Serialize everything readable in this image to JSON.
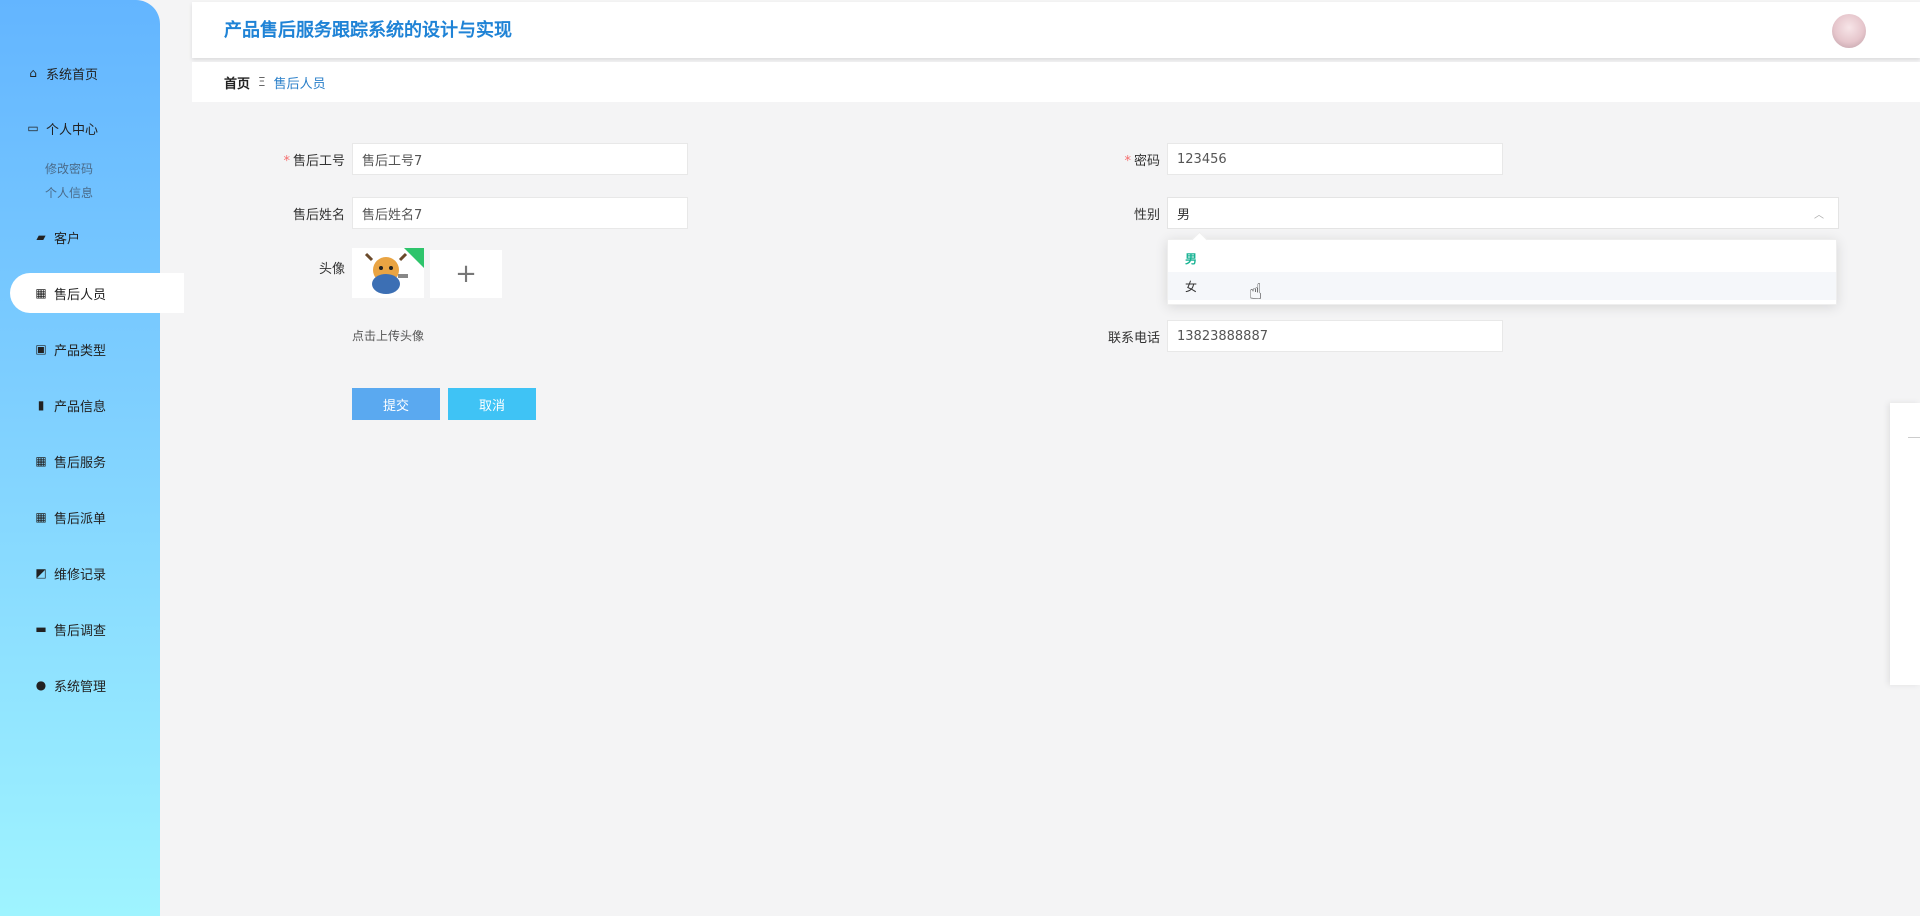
{
  "header": {
    "title": "产品售后服务跟踪系统的设计与实现"
  },
  "breadcrumb": {
    "home": "首页",
    "separator": "Ξ",
    "current": "售后人员"
  },
  "sidebar": {
    "items": [
      {
        "label": "系统首页",
        "icon": "home-icon"
      },
      {
        "label": "个人中心",
        "icon": "user-center-icon"
      },
      {
        "label": "客户",
        "icon": "wallet-icon"
      },
      {
        "label": "售后人员",
        "icon": "grid-icon"
      },
      {
        "label": "产品类型",
        "icon": "clipboard-icon"
      },
      {
        "label": "产品信息",
        "icon": "book-icon"
      },
      {
        "label": "售后服务",
        "icon": "grid-icon"
      },
      {
        "label": "售后派单",
        "icon": "grid-icon"
      },
      {
        "label": "维修记录",
        "icon": "chart-icon"
      },
      {
        "label": "售后调查",
        "icon": "monitor-icon"
      },
      {
        "label": "系统管理",
        "icon": "person-icon"
      }
    ],
    "sub_items": [
      {
        "label": "修改密码"
      },
      {
        "label": "个人信息"
      }
    ]
  },
  "form": {
    "staff_no": {
      "label": "售后工号",
      "value": "售后工号7"
    },
    "staff_name": {
      "label": "售后姓名",
      "value": "售后姓名7"
    },
    "avatar": {
      "label": "头像",
      "hint": "点击上传头像",
      "add_symbol": "+"
    },
    "password": {
      "label": "密码",
      "value": "123456"
    },
    "gender": {
      "label": "性别",
      "value": "男",
      "arrow": "︿"
    },
    "phone": {
      "label": "联系电话",
      "value": "13823888887"
    },
    "required_mark": "*",
    "submit_label": "提交",
    "cancel_label": "取消"
  },
  "gender_dropdown": {
    "options": [
      "男",
      "女"
    ],
    "selected": "男",
    "highlight_color": "#1ab394"
  },
  "colors": {
    "title": "#1f83d6",
    "submit": "#5aa9f0",
    "cancel": "#3fc3f5",
    "required": "#f56c6c"
  }
}
